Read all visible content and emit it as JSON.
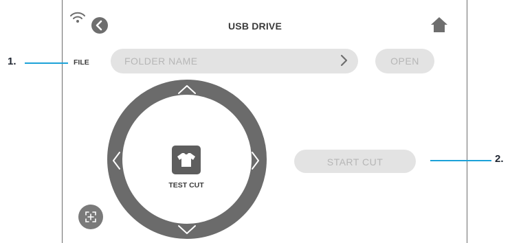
{
  "callouts": [
    {
      "number": "1."
    },
    {
      "number": "2."
    }
  ],
  "header": {
    "title": "USB DRIVE",
    "icons": {
      "wifi": "wifi-icon",
      "back": "chevron-left-icon",
      "home": "home-icon"
    }
  },
  "file_row": {
    "label": "FILE",
    "folder_field": "FOLDER NAME",
    "open_label": "OPEN"
  },
  "jog_dial": {
    "icons": [
      "chevron-up-icon",
      "chevron-down-icon",
      "chevron-left-icon",
      "chevron-right-icon"
    ],
    "center_icon": "tshirt-icon",
    "center_label": "TEST CUT"
  },
  "start_cut_label": "START CUT",
  "focus_icon": "crosshair-frame-icon",
  "colors": {
    "accent_callout": "#1ba1d8",
    "dial": "#6b6b6b",
    "pill": "#e3e3e3",
    "pill_text": "#b6b6b6",
    "text": "#3a3a3a"
  }
}
